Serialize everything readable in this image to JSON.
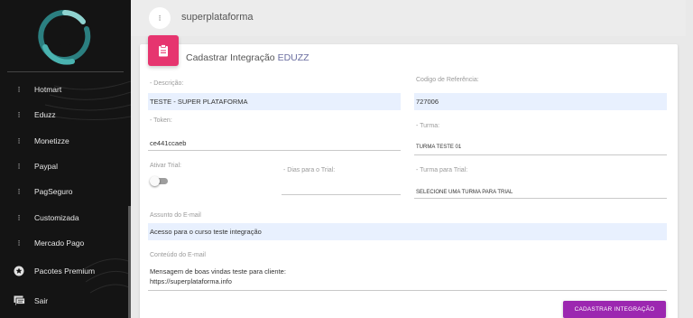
{
  "header": {
    "title": "superplataforma",
    "menu_glyph": "⁝"
  },
  "sidebar": {
    "items": [
      {
        "label": "Hotmart",
        "icon": "dot"
      },
      {
        "label": "Eduzz",
        "icon": "dot"
      },
      {
        "label": "Monetizze",
        "icon": "dot"
      },
      {
        "label": "Paypal",
        "icon": "dot"
      },
      {
        "label": "PagSeguro",
        "icon": "dot"
      },
      {
        "label": "Customizada",
        "icon": "dot"
      },
      {
        "label": "Mercado Pago",
        "icon": "dot"
      },
      {
        "label": "Pacotes Premium",
        "icon": "star-badge-icon"
      },
      {
        "label": "Sair",
        "icon": "chat-icon"
      }
    ],
    "dot_glyph": "⁝"
  },
  "form": {
    "title_prefix": "Cadastrar Integração ",
    "title_accent": "EDUZZ",
    "descricao": {
      "label": "- Descrição:",
      "value": "TESTE - SUPER PLATAFORMA"
    },
    "codigo": {
      "label": "Codigo de Referência:",
      "value": "727006"
    },
    "token": {
      "label": "- Token:",
      "value": "ce441ccaeb"
    },
    "turma": {
      "label": "- Turma:",
      "value": "TURMA TESTE 01"
    },
    "ativar_trial": {
      "label": "Ativar Trial:",
      "on": false
    },
    "dias_trial": {
      "label": "- Dias para o Trial:",
      "value": ""
    },
    "turma_trial": {
      "label": "- Turma para Trial:",
      "value": "SELECIONE UMA TURMA PARA TRIAL"
    },
    "assunto": {
      "label": "Assunto do E-mail",
      "value": "Acesso para o curso teste integração"
    },
    "conteudo": {
      "label": "Conteúdo do E-mail",
      "line1": "Mensagem de boas vindas teste para cliente:",
      "line2": "https://superplataforma.info"
    },
    "submit_label": "CADASTRAR INTEGRAÇÃO"
  },
  "colors": {
    "accent_pink": "#e6356f",
    "submit_purple": "#9c27b0",
    "sidebar_bg": "#141414",
    "autofill_blue": "#e8f0fe"
  }
}
